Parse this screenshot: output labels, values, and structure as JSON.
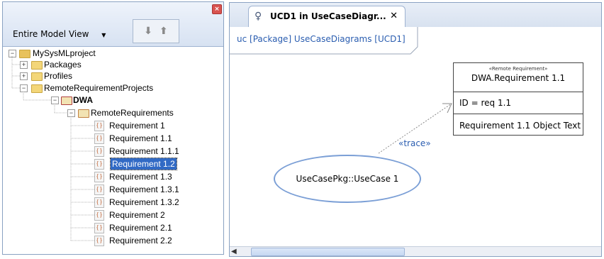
{
  "browser": {
    "view_label": "Entire Model View",
    "tree": [
      {
        "label": "MySysMLproject",
        "toggle": "−",
        "icon": "project-icon"
      },
      {
        "label": "Packages",
        "toggle": "+",
        "icon": "folder-icon"
      },
      {
        "label": "Profiles",
        "toggle": "+",
        "icon": "folder-icon"
      },
      {
        "label": "RemoteRequirementProjects",
        "toggle": "−",
        "icon": "folder-icon"
      },
      {
        "label": "DWA",
        "toggle": "−",
        "icon": "package-icon"
      },
      {
        "label": "RemoteRequirements",
        "toggle": "−",
        "icon": "package-icon"
      },
      {
        "label": "Requirement 1",
        "icon": "requirement-icon"
      },
      {
        "label": "Requirement 1.1",
        "icon": "requirement-icon"
      },
      {
        "label": "Requirement 1.1.1",
        "icon": "requirement-icon"
      },
      {
        "label": "Requirement 1.2",
        "icon": "requirement-icon"
      },
      {
        "label": "Requirement 1.3",
        "icon": "requirement-icon"
      },
      {
        "label": "Requirement 1.3.1",
        "icon": "requirement-icon"
      },
      {
        "label": "Requirement 1.3.2",
        "icon": "requirement-icon"
      },
      {
        "label": "Requirement 2",
        "icon": "requirement-icon"
      },
      {
        "label": "Requirement 2.1",
        "icon": "requirement-icon"
      },
      {
        "label": "Requirement 2.2",
        "icon": "requirement-icon"
      }
    ]
  },
  "editor": {
    "tab_title": "UCD1 in UseCaseDiagr...",
    "frame_label": "uc [Package] UseCaseDiagrams [UCD1]",
    "requirement": {
      "stereotype": "«Remote Requirement»",
      "name": "DWA.Requirement 1.1",
      "id": "ID = req 1.1",
      "text": "Requirement 1.1 Object Text"
    },
    "usecase_label": "UseCasePkg::UseCase 1",
    "trace_label": "«trace»"
  },
  "colors": {
    "selection": "#316ac5",
    "frame_text": "#2a5db0",
    "usecase_border": "#7b9fd6"
  }
}
